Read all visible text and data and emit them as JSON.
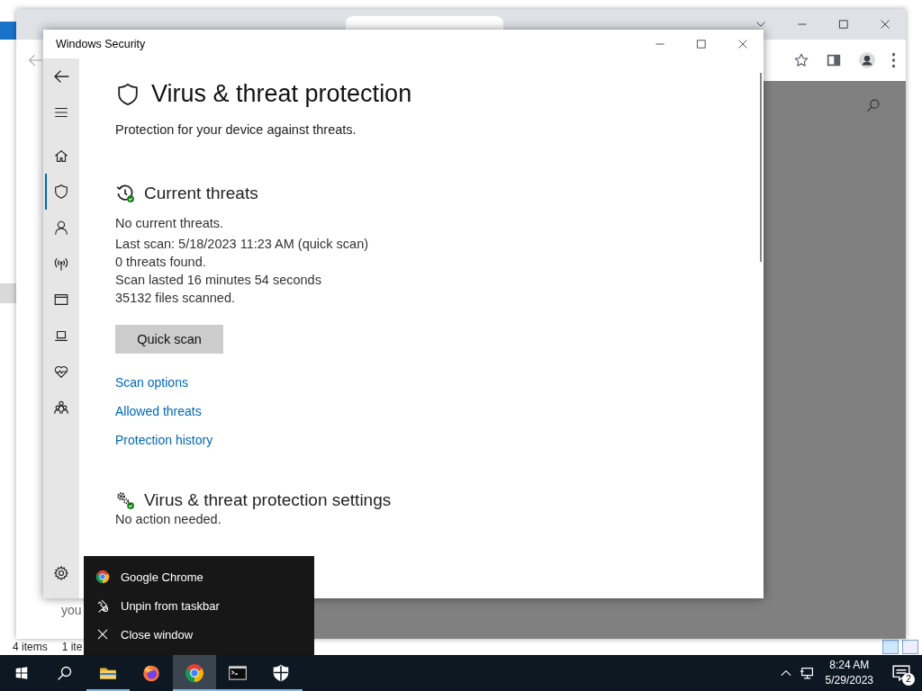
{
  "explorer_window": {
    "status_items": "4 items",
    "status_selected": "1 ite",
    "fragment": "you"
  },
  "security_window": {
    "title": "Windows Security",
    "nav": [
      {
        "kind": "menu",
        "selected": false
      },
      {
        "kind": "home",
        "selected": false
      },
      {
        "kind": "shield",
        "selected": true
      },
      {
        "kind": "person",
        "selected": false
      },
      {
        "kind": "wireless",
        "selected": false
      },
      {
        "kind": "browser",
        "selected": false
      },
      {
        "kind": "laptop",
        "selected": false
      },
      {
        "kind": "heart",
        "selected": false
      },
      {
        "kind": "family",
        "selected": false
      }
    ],
    "heading": "Virus & threat protection",
    "subtitle": "Protection for your device against threats.",
    "current_threats": {
      "title": "Current threats",
      "lines": [
        "No current threats.",
        "Last scan: 5/18/2023 11:23 AM (quick scan)",
        "0 threats found.",
        "Scan lasted 16 minutes 54 seconds",
        "35132 files scanned."
      ],
      "button": "Quick scan",
      "links": [
        "Scan options",
        "Allowed threats",
        "Protection history"
      ]
    },
    "settings_section": {
      "title": "Virus & threat protection settings",
      "status": "No action needed."
    }
  },
  "context_menu": [
    {
      "kind": "chrome",
      "label": "Google Chrome"
    },
    {
      "kind": "unpin",
      "label": "Unpin from taskbar"
    },
    {
      "kind": "close",
      "label": "Close window"
    }
  ],
  "taskbar": {
    "apps": [
      {
        "kind": "windows",
        "running": false,
        "selected": false
      },
      {
        "kind": "search",
        "running": false,
        "selected": false
      },
      {
        "kind": "folder",
        "running": true,
        "selected": false
      },
      {
        "kind": "firefox",
        "running": false,
        "selected": false
      },
      {
        "kind": "chrome",
        "running": true,
        "selected": true
      },
      {
        "kind": "terminal",
        "running": true,
        "selected": false
      },
      {
        "kind": "shieldfill",
        "running": true,
        "selected": false
      }
    ],
    "time": "8:24 AM",
    "date": "5/29/2023",
    "notification_count": "2"
  }
}
